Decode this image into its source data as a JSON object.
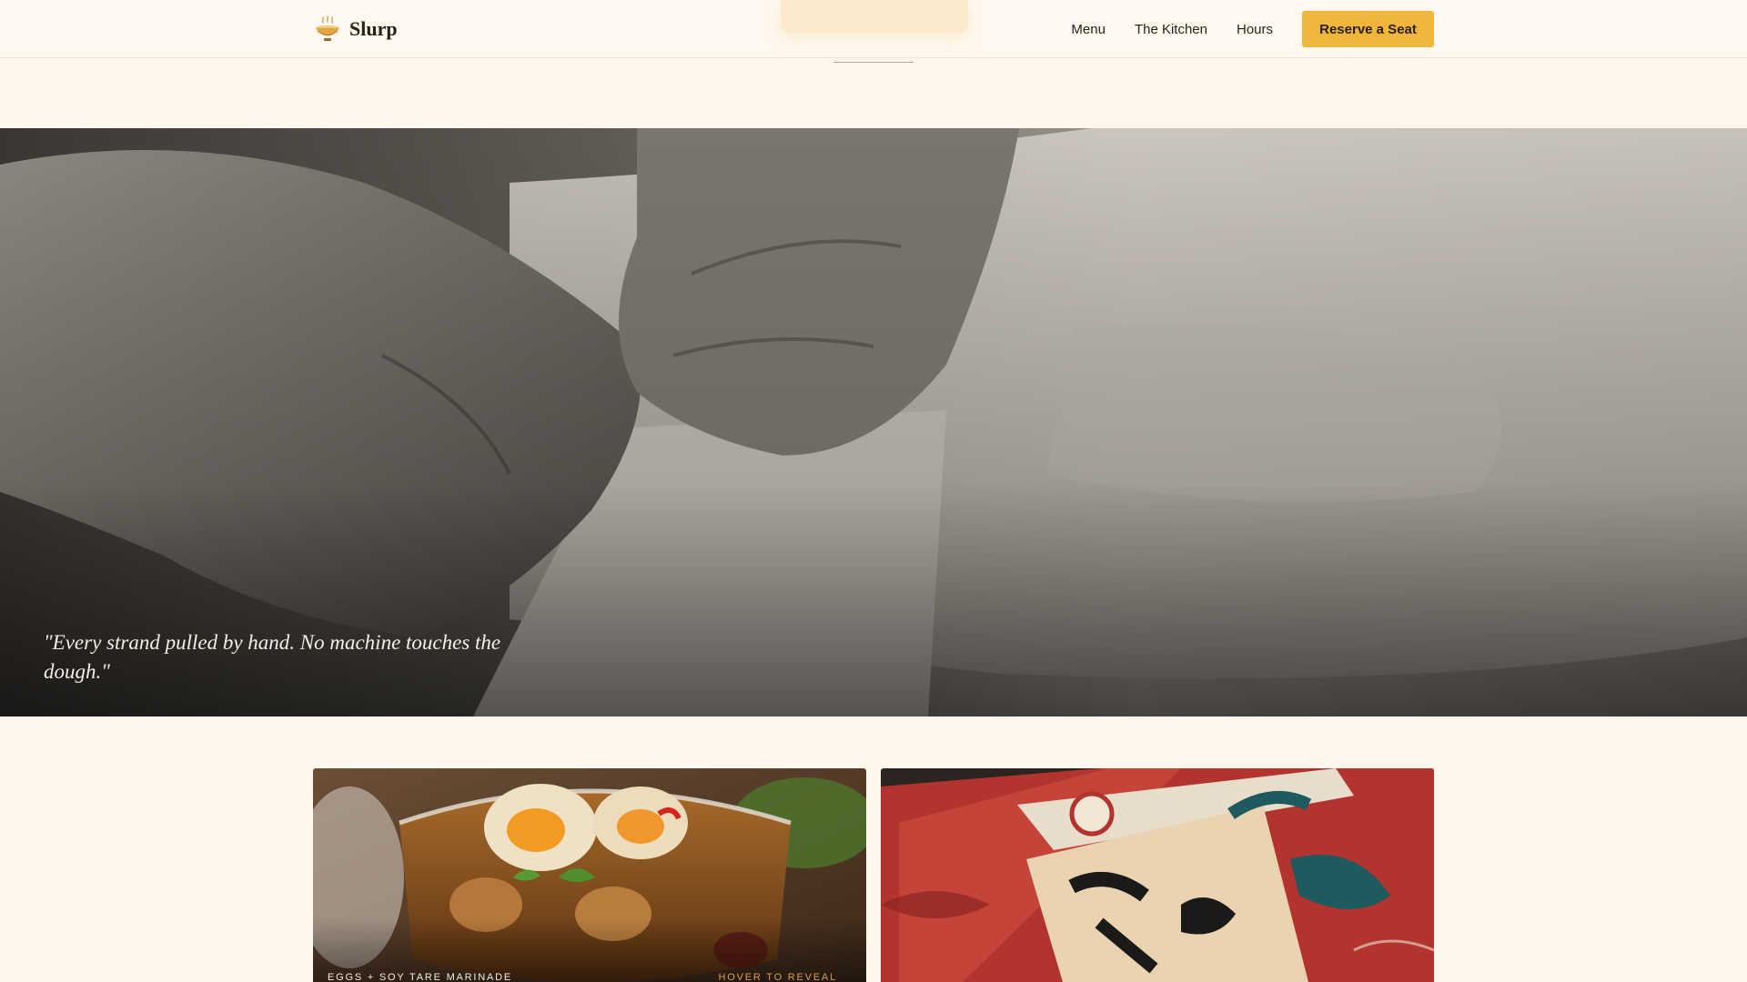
{
  "brand": {
    "name": "Slurp",
    "logo_icon": "ramen-bowl-icon"
  },
  "nav": {
    "items": [
      "Menu",
      "The Kitchen",
      "Hours"
    ],
    "cta_label": "Reserve a Seat"
  },
  "hero": {
    "quote": "\"Every strand pulled by hand. No machine touches the dough.\""
  },
  "cards": [
    {
      "caption": "EGGS + SOY TARE MARINADE",
      "hint": "HOVER TO REVEAL"
    },
    {
      "caption": "",
      "hint": ""
    }
  ],
  "colors": {
    "background": "#FEF7EE",
    "accent": "#F0B63C",
    "text": "#2A1F14",
    "hint": "#D9A04A"
  }
}
